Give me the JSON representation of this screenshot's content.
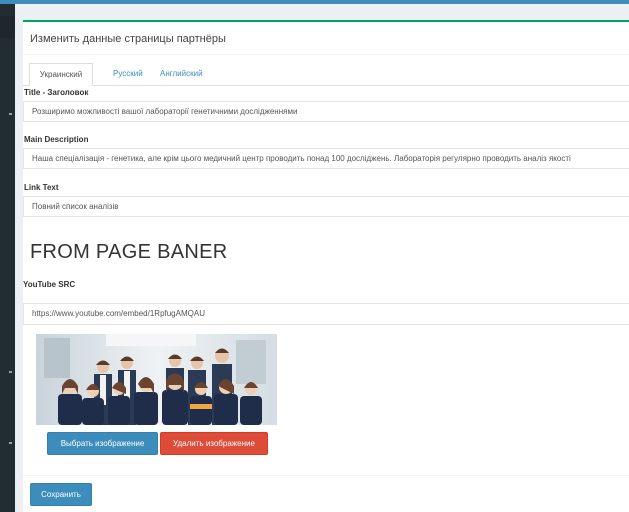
{
  "form": {
    "title": "Изменить данные страницы партнёры",
    "tabs": [
      {
        "label": "Украинский",
        "active": true
      },
      {
        "label": "Русский",
        "active": false
      },
      {
        "label": "Английский",
        "active": false
      }
    ],
    "fields": {
      "title_label": "Title - Заголовок",
      "title_value": "Розширимо можливості вашої лабораторії генетичними дослідженнями",
      "description_label": "Main Description",
      "description_value": "Наша спеціалізація - генетика, але крім цього медичний центр проводить понад 100 досліджень. Лабораторія регулярно проводить аналіз якості",
      "link_label": "Link Text",
      "link_value": "Повний список аналізів"
    },
    "banner_heading": "FROM PAGE BANER",
    "youtube_label": "YouTube SRC",
    "youtube_value": "https://www.youtube.com/embed/1RpfugAMQAU",
    "buttons": {
      "pick_image": "Выбрать изображение",
      "delete_image": "Удалить изображение",
      "save": "Сохранить"
    }
  },
  "colors": {
    "accent": "#3c8dbc",
    "danger": "#dd4b39",
    "success": "#00a65a",
    "sidebar": "#222d32"
  }
}
